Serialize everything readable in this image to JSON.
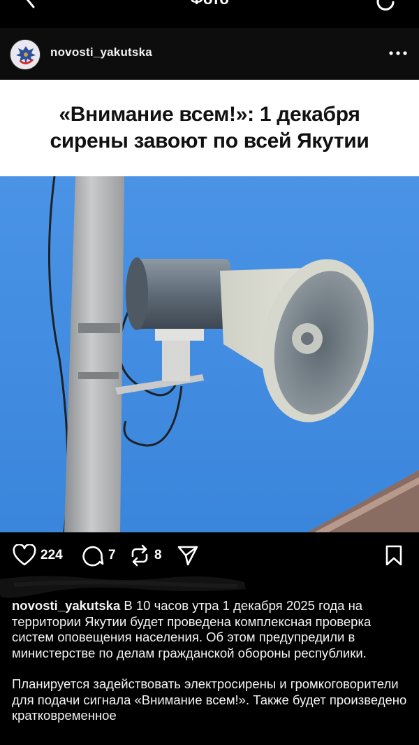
{
  "topbar": {
    "title": "Фото"
  },
  "post": {
    "username": "novosti_yakutska",
    "headline_line1": "«Внимание всем!»: 1 декабря",
    "headline_line2": "сирены завоют по всей Якутии",
    "likes": "224",
    "comments": "7",
    "reposts": "8"
  },
  "caption": {
    "username": "novosti_yakutska",
    "paragraph1": " В 10 часов утра 1 декабря 2025 года на территории Якутии будет проведена комплексная проверка систем оповещения населения. Об этом предупредили в министерстве по делам гражданской обороны республики.",
    "paragraph2": "Планируется задействовать электросирены и громкоговорители для подачи сигнала «Внимание всем!». Также будет произведено кратковременное"
  },
  "icons": {
    "back": "chevron-left-icon",
    "reload": "reload-icon",
    "more": "more-dots-icon",
    "like": "heart-icon",
    "comment": "comment-icon",
    "repost": "repost-icon",
    "share": "send-icon",
    "save": "bookmark-icon"
  },
  "colors": {
    "background": "#000000",
    "sky": "#3f8ee6",
    "text": "#ffffff"
  }
}
